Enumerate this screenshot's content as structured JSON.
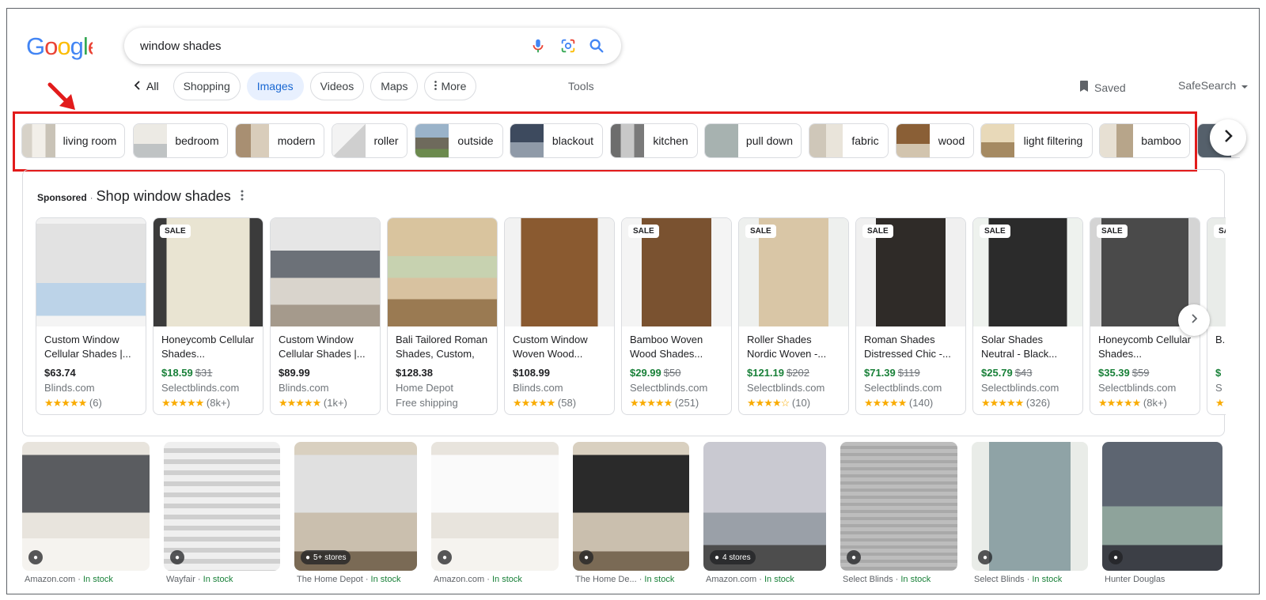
{
  "search": {
    "query": "window shades"
  },
  "nav": {
    "back_label": "All",
    "tabs": [
      {
        "label": "Shopping",
        "active": false
      },
      {
        "label": "Images",
        "active": true
      },
      {
        "label": "Videos",
        "active": false
      },
      {
        "label": "Maps",
        "active": false
      },
      {
        "label": "More",
        "active": false
      }
    ],
    "tools": "Tools",
    "saved": "Saved",
    "safesearch": "SafeSearch"
  },
  "chips": [
    {
      "label": "living room"
    },
    {
      "label": "bedroom"
    },
    {
      "label": "modern"
    },
    {
      "label": "roller"
    },
    {
      "label": "outside"
    },
    {
      "label": "blackout"
    },
    {
      "label": "kitchen"
    },
    {
      "label": "pull down"
    },
    {
      "label": "fabric"
    },
    {
      "label": "wood"
    },
    {
      "label": "light filtering"
    },
    {
      "label": "bamboo"
    }
  ],
  "sponsored": {
    "tag": "Sponsored",
    "title": "Shop window shades",
    "products": [
      {
        "title": "Custom Window Cellular Shades |...",
        "price": "$63.74",
        "old_price": "",
        "store": "Blinds.com",
        "stars": "★★★★★",
        "reviews": "(6)",
        "sale": false
      },
      {
        "title": "Honeycomb Cellular Shades...",
        "price": "$18.59",
        "old_price": "$31",
        "store": "Selectblinds.com",
        "stars": "★★★★★",
        "reviews": "(8k+)",
        "sale": true
      },
      {
        "title": "Custom Window Cellular Shades |...",
        "price": "$89.99",
        "old_price": "",
        "store": "Blinds.com",
        "stars": "★★★★★",
        "reviews": "(1k+)",
        "sale": false
      },
      {
        "title": "Bali Tailored Roman Shades, Custom, 9...",
        "price": "$128.38",
        "old_price": "",
        "store": "Home Depot",
        "stars": "",
        "reviews": "Free shipping",
        "sale": false
      },
      {
        "title": "Custom Window Woven Wood...",
        "price": "$108.99",
        "old_price": "",
        "store": "Blinds.com",
        "stars": "★★★★★",
        "reviews": "(58)",
        "sale": false
      },
      {
        "title": "Bamboo Woven Wood Shades...",
        "price": "$29.99",
        "old_price": "$50",
        "store": "Selectblinds.com",
        "stars": "★★★★★",
        "reviews": "(251)",
        "sale": true
      },
      {
        "title": "Roller Shades Nordic Woven -...",
        "price": "$121.19",
        "old_price": "$202",
        "store": "Selectblinds.com",
        "stars": "★★★★☆",
        "reviews": "(10)",
        "sale": true
      },
      {
        "title": "Roman Shades Distressed Chic -...",
        "price": "$71.39",
        "old_price": "$119",
        "store": "Selectblinds.com",
        "stars": "★★★★★",
        "reviews": "(140)",
        "sale": true
      },
      {
        "title": "Solar Shades Neutral - Black...",
        "price": "$25.79",
        "old_price": "$43",
        "store": "Selectblinds.com",
        "stars": "★★★★★",
        "reviews": "(326)",
        "sale": true
      },
      {
        "title": "Honeycomb Cellular Shades...",
        "price": "$35.39",
        "old_price": "$59",
        "store": "Selectblinds.com",
        "stars": "★★★★★",
        "reviews": "(8k+)",
        "sale": true
      },
      {
        "title": "B... W...",
        "price": "$",
        "old_price": "",
        "store": "S",
        "stars": "★",
        "reviews": "",
        "sale": true
      }
    ],
    "sale_label": "SALE"
  },
  "images": [
    {
      "source": "Amazon.com",
      "stock": "In stock",
      "tag": ""
    },
    {
      "source": "Wayfair",
      "stock": "In stock",
      "tag": ""
    },
    {
      "source": "The Home Depot",
      "stock": "In stock",
      "tag": "5+ stores"
    },
    {
      "source": "Amazon.com",
      "stock": "In stock",
      "tag": ""
    },
    {
      "source": "The Home De...",
      "stock": "In stock",
      "tag": ""
    },
    {
      "source": "Amazon.com",
      "stock": "In stock",
      "tag": "4 stores"
    },
    {
      "source": "Select Blinds",
      "stock": "In stock",
      "tag": ""
    },
    {
      "source": "Select Blinds",
      "stock": "In stock",
      "tag": ""
    },
    {
      "source": "Hunter Douglas",
      "stock": "",
      "tag": ""
    }
  ],
  "colors": {
    "accent_blue": "#1a73e8",
    "active_tab_bg": "#e8f0fe",
    "sale_green": "#188038",
    "star_yellow": "#f9ab00",
    "annotation_red": "#e21b1b"
  },
  "icons": {
    "mic": "mic-icon",
    "lens": "google-lens-icon",
    "search": "search-icon",
    "saved": "bookmark-icon",
    "next": "chevron-right-icon"
  }
}
